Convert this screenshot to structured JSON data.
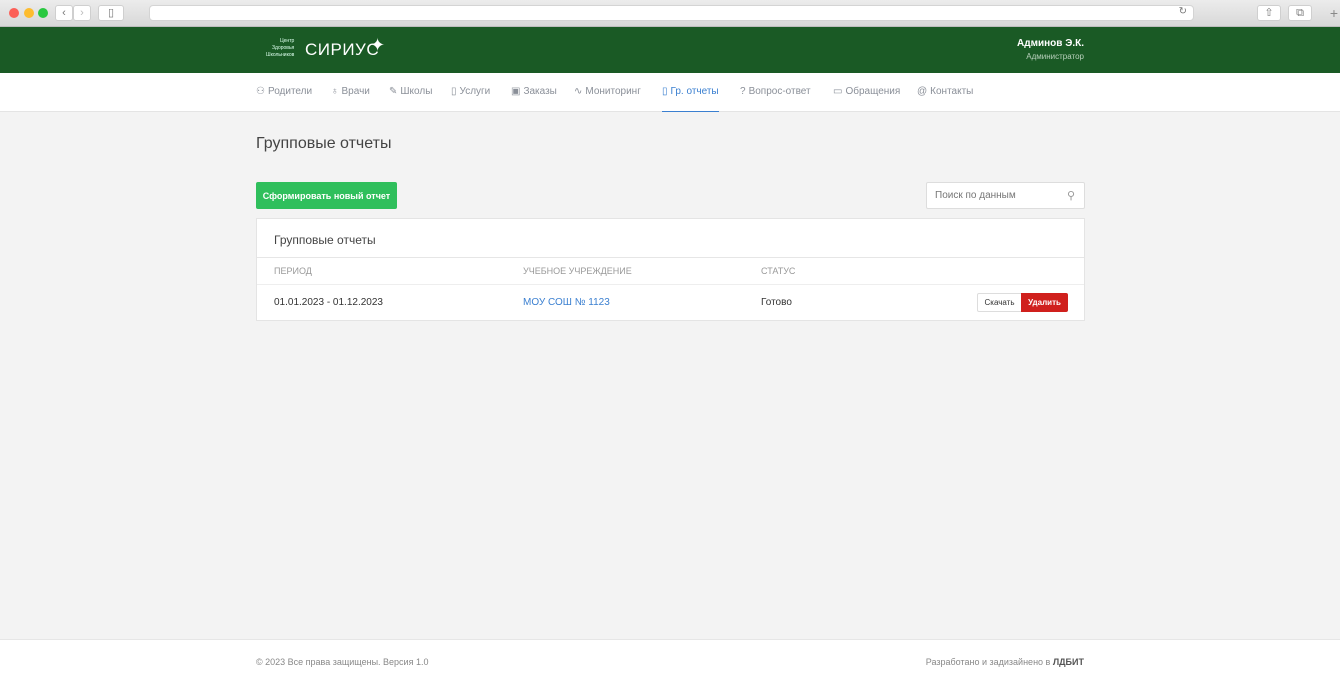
{
  "header": {
    "logo_small": [
      "Центр",
      "Здоровья",
      "Школьников"
    ],
    "logo": "СИРИУС",
    "user_name": "Админов Э.К.",
    "user_role": "Администратор"
  },
  "nav": [
    {
      "icon": "users-icon",
      "glyph": "⚇",
      "label": "Родители"
    },
    {
      "icon": "award-icon",
      "glyph": "♁",
      "label": "Врачи"
    },
    {
      "icon": "edit-icon",
      "glyph": "✎",
      "label": "Школы"
    },
    {
      "icon": "book-icon",
      "glyph": "▯",
      "label": "Услуги"
    },
    {
      "icon": "box-icon",
      "glyph": "▣",
      "label": "Заказы"
    },
    {
      "icon": "activity-icon",
      "glyph": "∿",
      "label": "Мониторинг"
    },
    {
      "icon": "clipboard-icon",
      "glyph": "▯",
      "label": "Гр. отчеты",
      "active": true
    },
    {
      "icon": "help-icon",
      "glyph": "?",
      "label": "Вопрос-ответ"
    },
    {
      "icon": "message-icon",
      "glyph": "▭",
      "label": "Обращения"
    },
    {
      "icon": "at-icon",
      "glyph": "@",
      "label": "Контакты"
    }
  ],
  "page": {
    "title": "Групповые отчеты",
    "new_button": "Сформировать новый отчет",
    "search_placeholder": "Поиск по данным"
  },
  "table": {
    "title": "Групповые отчеты",
    "columns": [
      "ПЕРИОД",
      "УЧЕБНОЕ УЧРЕЖДЕНИЕ",
      "СТАТУС"
    ],
    "rows": [
      {
        "period": "01.01.2023 - 01.12.2023",
        "school": "МОУ СОШ № 1123",
        "status": "Готово",
        "download": "Скачать",
        "delete": "Удалить"
      }
    ]
  },
  "footer": {
    "left": "© 2023 Все права защищены. Версия 1.0",
    "right_prefix": "Разработано и задизайнено в ",
    "right_brand": "ЛДБИТ"
  },
  "colors": {
    "brand": "#1a5a25",
    "accent": "#3a7fd0",
    "success": "#2fbf5c",
    "danger": "#d0201d"
  }
}
